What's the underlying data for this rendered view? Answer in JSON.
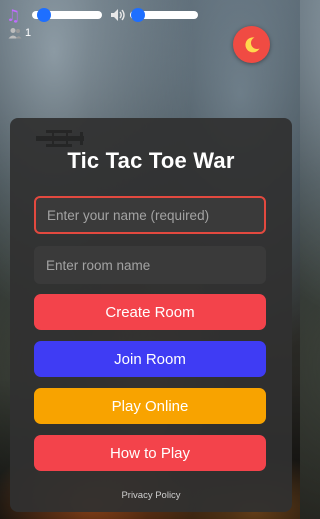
{
  "colors": {
    "accent_red": "#f3434b",
    "accent_blue": "#3f3cf4",
    "accent_yellow": "#f8a300",
    "slider_knob": "#1e6fff",
    "theme_button": "#f04b43",
    "card_background": "#303030"
  },
  "audio": {
    "music_icon": "music-note-icon",
    "music_volume": 0.1,
    "sound_icon": "speaker-icon",
    "sound_volume": 0.05
  },
  "players": {
    "icon": "users-icon",
    "count": "1"
  },
  "theme_toggle": {
    "icon": "moon-icon"
  },
  "card": {
    "title": "Tic Tac Toe War",
    "name_input": {
      "value": "",
      "placeholder": "Enter your name (required)"
    },
    "room_input": {
      "value": "",
      "placeholder": "Enter room name"
    },
    "buttons": {
      "create_room": "Create Room",
      "join_room": "Join Room",
      "play_online": "Play Online",
      "how_to_play": "How to Play"
    },
    "privacy_link": "Privacy Policy"
  }
}
